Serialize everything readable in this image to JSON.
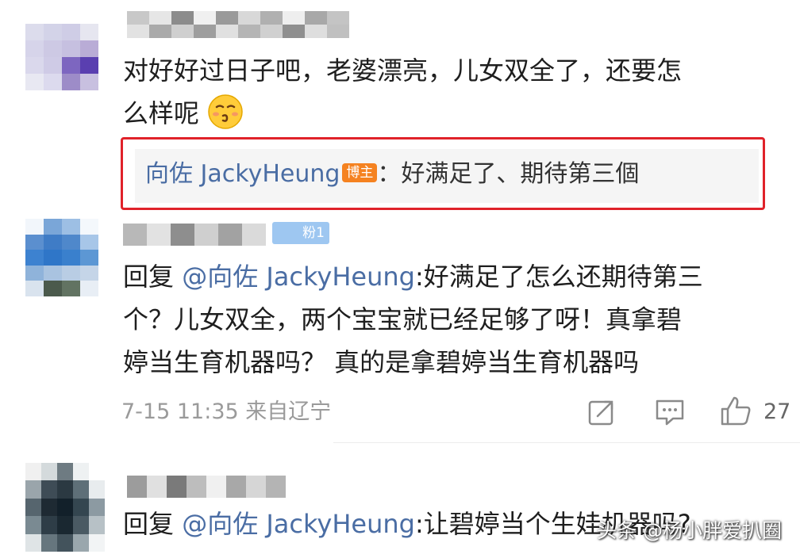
{
  "comments": [
    {
      "text": "对好好过日子吧，老婆漂亮，儿女双全了，还要怎",
      "text_line2": "么样呢",
      "emoji": "kissing-face-emoji",
      "author_reply": {
        "author": "向佐 JackyHeung",
        "badge": "博主",
        "text": "：好满足了、期待第三個"
      }
    },
    {
      "fans_badge": "粉1",
      "mention_prefix": "回复 ",
      "mention": "@向佐 JackyHeung",
      "line1_rest": ":好满足了怎么还期待第三",
      "line2": "个？儿女双全，两个宝宝就已经足够了呀！真拿碧",
      "line3": "婷当生育机器吗？  真的是拿碧婷当生育机器吗",
      "timestamp": "7-15 11:35",
      "location": "来自辽宁",
      "like_count": "27"
    },
    {
      "mention_prefix": "回复 ",
      "mention": "@向佐 JackyHeung",
      "rest": ":让碧婷当个生娃机器吗?"
    }
  ],
  "watermark": "头条 @杨小胖爱扒圈",
  "colors": {
    "highlight_border": "#e0222a",
    "mention": "#4a6da4",
    "badge": "#f58220",
    "fans_badge": "#9ec7f1"
  }
}
